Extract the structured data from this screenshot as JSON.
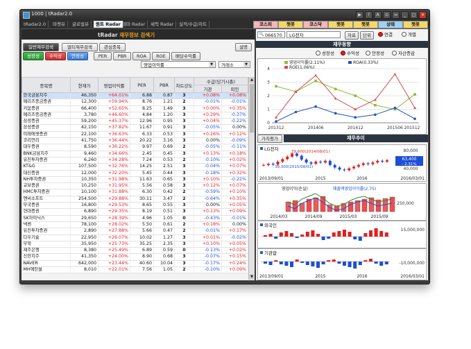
{
  "window": {
    "title": "1000 | tRadar2.0",
    "controls": [
      "▶",
      "?",
      "A",
      "⊙",
      "↔",
      "_",
      "□",
      "×"
    ]
  },
  "menu": {
    "tabs": [
      "tRadar2.0",
      "마켓뷰",
      "글로벌뷰",
      "퀀트 Radar",
      "테마 Radar",
      "세력 Radar",
      "실적/수급/차트"
    ],
    "active_index": 3
  },
  "quick_tabs": [
    {
      "label": "코스피",
      "bg": "#f4b6b6"
    },
    {
      "label": "챗봇",
      "bg": "#f4d66a"
    },
    {
      "label": "코스닥",
      "bg": "#f4b6b6"
    },
    {
      "label": "챗봇",
      "bg": "#f4d66a"
    },
    {
      "label": "챗봇",
      "bg": "#f4d66a"
    },
    {
      "label": "상태",
      "bg": "#9fd0f0"
    },
    {
      "label": "챗봇",
      "bg": "#f4d66a"
    }
  ],
  "left": {
    "header_prefix": "tRadar",
    "header_title": "재무정보 검색기",
    "tabs": [
      "일반재무검색",
      "멀티재무검색",
      "관심종목"
    ],
    "top_right_btn": "설명",
    "filters": [
      "성장성",
      "수익성",
      "안정성",
      "PER",
      "PBR",
      "ROA",
      "ROE",
      "배당수익률"
    ],
    "select_metric": "영업이익률",
    "select_order": "거래소",
    "columns": [
      "종목명",
      "현재가",
      "영업이익률",
      "PER",
      "PBR",
      "차트강도",
      "기관",
      "외인"
    ],
    "supply_header": "수급(당기시총)",
    "rows": [
      {
        "name": "한국금융지주",
        "price": "46,350",
        "opm": "+64.01%",
        "per": "6.88",
        "pbr": "0.87",
        "str": "3",
        "inst": "+0.08%",
        "foreign": "+0.08%"
      },
      {
        "name": "메리츠종금증권",
        "price": "12,300",
        "opm": "+59.94%",
        "per": "8.76",
        "pbr": "1.21",
        "str": "2",
        "inst": "-0.01%",
        "foreign": "-0.01%"
      },
      {
        "name": "키움증권",
        "price": "66,400",
        "opm": "+52.65%",
        "per": "8.25",
        "pbr": "1.49",
        "str": "3",
        "inst": "+0.00%",
        "foreign": "+0.35%"
      },
      {
        "name": "메리츠종금증권",
        "price": "3,780",
        "opm": "+46.60%",
        "per": "4.84",
        "pbr": "1.20",
        "str": "3",
        "inst": "+0.29%",
        "foreign": "-0.37%"
      },
      {
        "name": "삼성증권",
        "price": "59,200",
        "opm": "+45.37%",
        "per": "12.96",
        "pbr": "0.95",
        "str": "3",
        "inst": "+0.04%",
        "foreign": "-0.22%"
      },
      {
        "name": "삼성증권",
        "price": "42,150",
        "opm": "+37.82%",
        "per": "11.67",
        "pbr": "0.91",
        "str": "3",
        "inst": "-0.05%",
        "foreign": "0.00%"
      },
      {
        "name": "미래에셋증권",
        "price": "22,100",
        "opm": "+36.63%",
        "per": "6.33",
        "pbr": "0.53",
        "str": "3",
        "inst": "+0.26%",
        "foreign": "+0.12%"
      },
      {
        "name": "코리안리",
        "price": "41,750",
        "opm": "+36.44%",
        "per": "20.22",
        "pbr": "3.16",
        "str": "3",
        "inst": "0.00%",
        "foreign": "-0.09%"
      },
      {
        "name": "대우증권",
        "price": "8,590",
        "opm": "+36.22%",
        "per": "9.97",
        "pbr": "0.69",
        "str": "2",
        "inst": "-0.05%",
        "foreign": "-0.11%"
      },
      {
        "name": "BNK금융지주",
        "price": "9,460",
        "opm": "+34.66%",
        "per": "2.45",
        "pbr": "0.45",
        "str": "3",
        "inst": "+0.13%",
        "foreign": "+0.18%"
      },
      {
        "name": "유진투자증권",
        "price": "6,260",
        "opm": "+34.28%",
        "per": "7.24",
        "pbr": "0.53",
        "str": "2",
        "inst": "-0.10%",
        "foreign": "+0.02%"
      },
      {
        "name": "KT&G",
        "price": "107,500",
        "opm": "+32.76%",
        "per": "14.25",
        "pbr": "2.51",
        "str": "3",
        "inst": "-0.04%",
        "foreign": "+0.07%"
      },
      {
        "name": "대신증권",
        "price": "12,000",
        "opm": "+32.20%",
        "per": "5.45",
        "pbr": "0.44",
        "str": "3",
        "inst": "-0.18%",
        "foreign": "+0.32%"
      },
      {
        "name": "NH투자증권",
        "price": "10,350",
        "opm": "+31.98%",
        "per": "11.63",
        "pbr": "0.65",
        "str": "3",
        "inst": "+0.10%",
        "foreign": "-0.22%"
      },
      {
        "name": "교보증권",
        "price": "10,250",
        "opm": "+31.95%",
        "per": "5.56",
        "pbr": "0.58",
        "str": "3",
        "inst": "+0.12%",
        "foreign": "+0.07%"
      },
      {
        "name": "HMC투자증권",
        "price": "10,100",
        "opm": "+31.88%",
        "per": "6.30",
        "pbr": "0.42",
        "str": "2",
        "inst": "-0.59%",
        "foreign": "+0.10%"
      },
      {
        "name": "엔씨소프트",
        "price": "254,500",
        "opm": "+29.88%",
        "per": "30.11",
        "pbr": "3.47",
        "str": "2",
        "inst": "-0.64%",
        "foreign": "+0.35%"
      },
      {
        "name": "부국증권",
        "price": "16,800",
        "opm": "+29.53%",
        "per": "8.65",
        "pbr": "0.55",
        "str": "3",
        "inst": "0.00%",
        "foreign": "+0.05%"
      },
      {
        "name": "현대증권",
        "price": "6,890",
        "opm": "+29.35%",
        "per": "8.19",
        "pbr": "0.51",
        "str": "3",
        "inst": "+0.13%",
        "foreign": "+0.09%"
      },
      {
        "name": "SK하이닉스",
        "price": "29,650",
        "opm": "+28.39%",
        "per": "4.96",
        "pbr": "1.05",
        "str": "0",
        "inst": "-0.43%",
        "foreign": "-0.01%"
      },
      {
        "name": "넥센",
        "price": "78,100",
        "opm": "+28.02%",
        "per": "5.50",
        "pbr": "0.61",
        "str": "2",
        "inst": "+0.18%",
        "foreign": "0.00%"
      },
      {
        "name": "유진투자증권",
        "price": "2,890",
        "opm": "+27.88%",
        "per": "5.66",
        "pbr": "0.47",
        "str": "2",
        "inst": "-0.01%",
        "foreign": "+0.17%"
      },
      {
        "name": "다우기술",
        "price": "22,950",
        "opm": "+26.07%",
        "per": "10.02",
        "pbr": "1.27",
        "str": "3",
        "inst": "+0.01%",
        "foreign": "-0.02%"
      },
      {
        "name": "무학",
        "price": "35,950",
        "opm": "+25.73%",
        "per": "35.25",
        "pbr": "2.35",
        "str": "3",
        "inst": "+0.10%",
        "foreign": "+0.05%"
      },
      {
        "name": "제주은행",
        "price": "8,380",
        "opm": "+25.49%",
        "per": "6.89",
        "pbr": "0.59",
        "str": "0",
        "inst": "-0.13%",
        "foreign": "+0.02%"
      },
      {
        "name": "신한지주",
        "price": "41,350",
        "opm": "+24.00%",
        "per": "8.90",
        "pbr": "0.68",
        "str": "3",
        "inst": "-0.07%",
        "foreign": "+0.15%"
      },
      {
        "name": "NAVER",
        "price": "642,000",
        "opm": "+23.44%",
        "per": "40.60",
        "pbr": "10.04",
        "str": "3",
        "inst": "-0.17%",
        "foreign": "+0.24%"
      },
      {
        "name": "MH에탄올",
        "price": "8,010",
        "opm": "+22.01%",
        "per": "7.56",
        "pbr": "1.05",
        "str": "2",
        "inst": "-0.10%",
        "foreign": "+0.09%"
      }
    ],
    "selected_row": 0
  },
  "right": {
    "stock_code": "066570",
    "stock_name": "LG전자",
    "btn_detail": "자료",
    "btn_setup": "단위",
    "radio_linked": "연결",
    "radio_separate": "개별",
    "section_trend": "재무동향",
    "metric_radios": [
      "성장성",
      "수익성",
      "안정성",
      "자산증감"
    ],
    "active_metric": 1,
    "section_chart": "재무추이",
    "tab_value": "가치평가",
    "stock_label": "LG전자"
  },
  "chart_data": [
    {
      "type": "line",
      "title": "",
      "x": [
        "201312",
        "201406",
        "201412",
        "201506",
        "201512"
      ],
      "ylim": [
        0,
        4
      ],
      "yticks": [
        0,
        1,
        2,
        3,
        4
      ],
      "series": [
        {
          "name": "영업이익률(2.11%)",
          "color": "#8bbd3a",
          "values": [
            2.7,
            2.3,
            3.1,
            2.5,
            2.0,
            1.3,
            1.0,
            2.1
          ]
        },
        {
          "name": "ROA(0.33%)",
          "color": "#1e50c0",
          "values": [
            0.1,
            0.8,
            1.2,
            0.7,
            0.4,
            0.6,
            1.1,
            0.3
          ]
        },
        {
          "name": "ROE(1.06%)",
          "color": "#d84a4a",
          "values": [
            0.4,
            2.3,
            3.5,
            1.8,
            1.0,
            1.7,
            3.6,
            1.1
          ]
        }
      ]
    },
    {
      "type": "line",
      "title": "LG전자",
      "x": [
        "2013/09/01",
        "2015",
        "2016",
        "2016/03/01"
      ],
      "ylim": [
        30000,
        90000
      ],
      "yticks": [
        "80,000",
        "40,000"
      ],
      "annotations": [
        "79,600(2014/08/01)",
        "39,300(2015/08/01)"
      ],
      "current_price_label": "63,400",
      "current_change_label": "- 2.31%"
    },
    {
      "type": "bar",
      "title": "",
      "series_labels": [
        "영업이익(순실)",
        "매출액영업이익률(2.75)"
      ],
      "x": [
        "2014/03",
        "2014/09",
        "2015/03",
        "2015/09"
      ],
      "ytick": "250,000"
    },
    {
      "type": "bar",
      "title": "외국인",
      "x": [
        "2013/09/01",
        "2015",
        "2016",
        "2016/03/01"
      ],
      "ytick": "15,000,000"
    },
    {
      "type": "bar",
      "title": "기관합",
      "x": [
        "2013/09/01",
        "2015",
        "2016",
        "2016/03/01"
      ],
      "ytick": "-10,000,000"
    }
  ]
}
